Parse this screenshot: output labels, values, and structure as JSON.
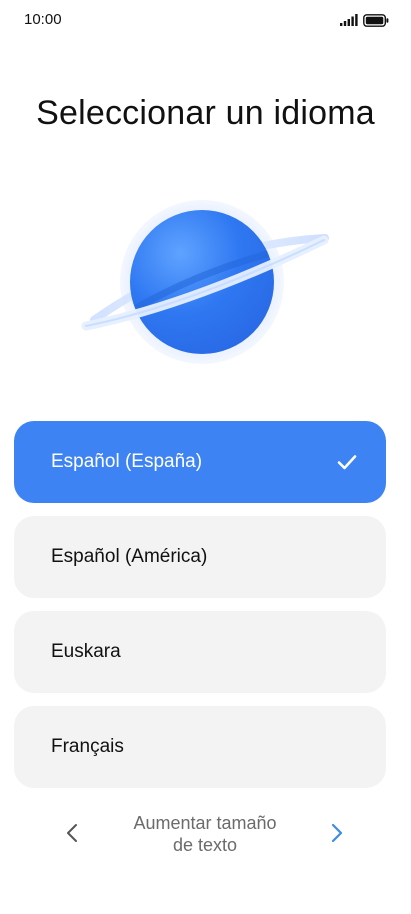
{
  "status_bar": {
    "time": "10:00",
    "icons": [
      "signal-icon",
      "battery-icon"
    ]
  },
  "title": "Seleccionar un idioma",
  "illustration": "planet-illustration",
  "languages": [
    {
      "label": "Español (España)",
      "selected": true
    },
    {
      "label": "Español (América)",
      "selected": false
    },
    {
      "label": "Euskara",
      "selected": false
    },
    {
      "label": "Français",
      "selected": false
    }
  ],
  "bottom_nav": {
    "prev_icon": "chevron-left-icon",
    "next_icon": "chevron-right-icon",
    "center_line1": "Aumentar tamaño",
    "center_line2": "de texto"
  },
  "colors": {
    "accent": "#3d83f4",
    "item_bg": "#f3f3f3",
    "next_arrow": "#3d8be8",
    "prev_arrow": "#555555"
  }
}
